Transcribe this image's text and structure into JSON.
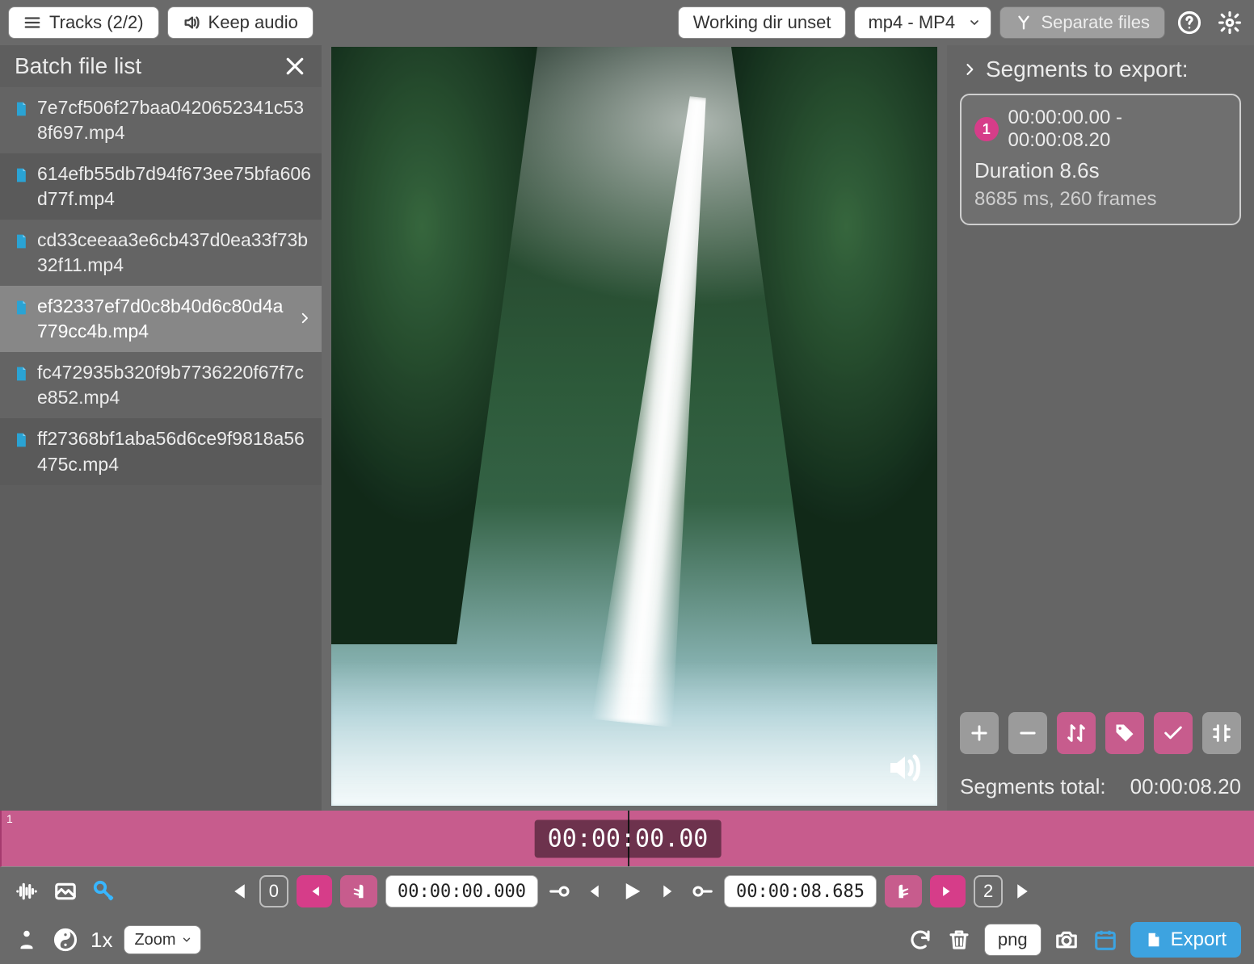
{
  "topbar": {
    "tracks_label": "Tracks (2/2)",
    "keep_audio_label": "Keep audio",
    "working_dir": "Working dir unset",
    "format": "mp4 - MP4",
    "separate_files": "Separate files"
  },
  "filelist": {
    "title": "Batch file list",
    "items": [
      "7e7cf506f27baa0420652341c538f697.mp4",
      "614efb55db7d94f673ee75bfa606d77f.mp4",
      "cd33ceeaa3e6cb437d0ea33f73b32f11.mp4",
      "ef32337ef7d0c8b40d6c80d4a779cc4b.mp4",
      "fc472935b320f9b7736220f67f7ce852.mp4",
      "ff27368bf1aba56d6ce9f9818a56475c.mp4"
    ],
    "selected_index": 3
  },
  "segments": {
    "header": "Segments to export:",
    "items": [
      {
        "index": "1",
        "range": "00:00:00.00 - 00:00:08.20",
        "duration": "Duration 8.6s",
        "detail": "8685 ms, 260 frames"
      }
    ],
    "total_label": "Segments total:",
    "total_value": "00:00:08.20"
  },
  "timeline": {
    "segment_label": "1",
    "display_time": "00:00:00.00"
  },
  "transport": {
    "marker0": "0",
    "start_time": "00:00:00.000",
    "end_time": "00:00:08.685",
    "marker2": "2"
  },
  "bottom": {
    "speed": "1x",
    "zoom_label": "Zoom",
    "capture_format": "png",
    "export_label": "Export"
  }
}
